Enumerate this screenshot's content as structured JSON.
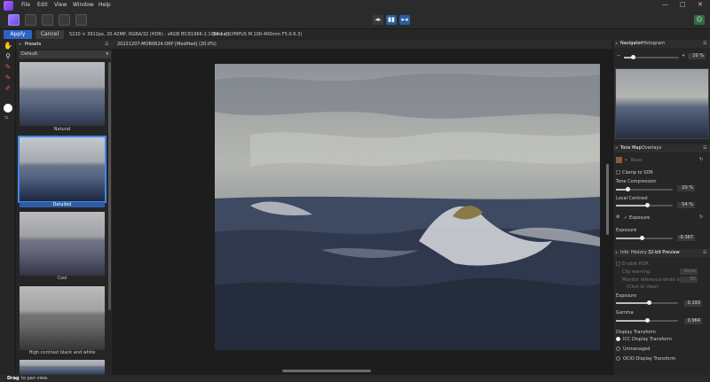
{
  "menubar": {
    "items": [
      "File",
      "Edit",
      "View",
      "Window",
      "Help"
    ],
    "window_controls": [
      "—",
      "□",
      "✕"
    ]
  },
  "context": {
    "apply": "Apply",
    "cancel": "Cancel",
    "info": "5220 × 3912px, 20.42MP, RGBA/32 (HDR) - sRGB IEC61966-2.1 (Linear)",
    "camera": "OM-1 (OLYMPUS M.100-400mm F5.0-6.3)"
  },
  "presets": {
    "tab": "Presets",
    "dropdown": "Default",
    "items": [
      {
        "label": "Natural"
      },
      {
        "label": "Detailed"
      },
      {
        "label": "Cool"
      },
      {
        "label": "High contrast black and white"
      }
    ]
  },
  "document": {
    "title": "20221207-MOR0624.ORF [Modified] (20.0%)"
  },
  "navigator": {
    "tabs": [
      "Navigator",
      "Histogram"
    ],
    "zoom": "20 %"
  },
  "tonemap": {
    "tabs": [
      "Tone Map",
      "Overlays"
    ],
    "preset": "Base",
    "clamp_label": "Clamp to SDR",
    "tone_compression_label": "Tone Compression",
    "tone_compression_value": "20 %",
    "tone_compression_pct": 20,
    "local_contrast_label": "Local Contrast",
    "local_contrast_value": "54 %",
    "local_contrast_pct": 54,
    "exposure_group": "Exposure",
    "exposure_label": "Exposure",
    "exposure_value": "-0.367",
    "exposure_pct": 45
  },
  "preview": {
    "tabs": [
      "Info",
      "History",
      "32-bit Preview"
    ],
    "enable_hdr": "Enable HDR",
    "clip_warning": "Clip warning:",
    "clip_warning_value": "None",
    "monitor_ref": "Monitor reference white (nits):",
    "monitor_ref_value": "80",
    "click_to_view": "(Click to View)",
    "exposure_label": "Exposure",
    "exposure_value": "0.193",
    "exposure_pct": 53,
    "gamma_label": "Gamma",
    "gamma_value": "0.964",
    "gamma_pct": 50,
    "display_transform": "Display Transform",
    "icc": "ICC Display Transform",
    "unmanaged": "Unmanaged",
    "ocio": "OCIO Display Transform"
  },
  "status": {
    "bold": "Drag",
    "text": " to pan view."
  }
}
